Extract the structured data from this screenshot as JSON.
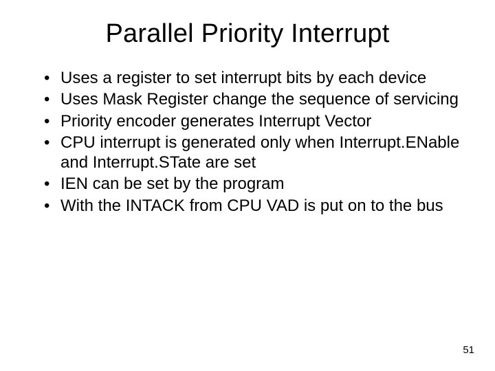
{
  "title": "Parallel Priority Interrupt",
  "bullets": [
    "Uses a register to set interrupt bits by each device",
    "Uses Mask Register change the sequence of servicing",
    "Priority encoder generates Interrupt Vector",
    "CPU interrupt is generated only when Interrupt.ENable and Interrupt.STate are set",
    "IEN can be set by the program",
    "With the INTACK from CPU VAD is put on to the bus"
  ],
  "pageNumber": "51"
}
